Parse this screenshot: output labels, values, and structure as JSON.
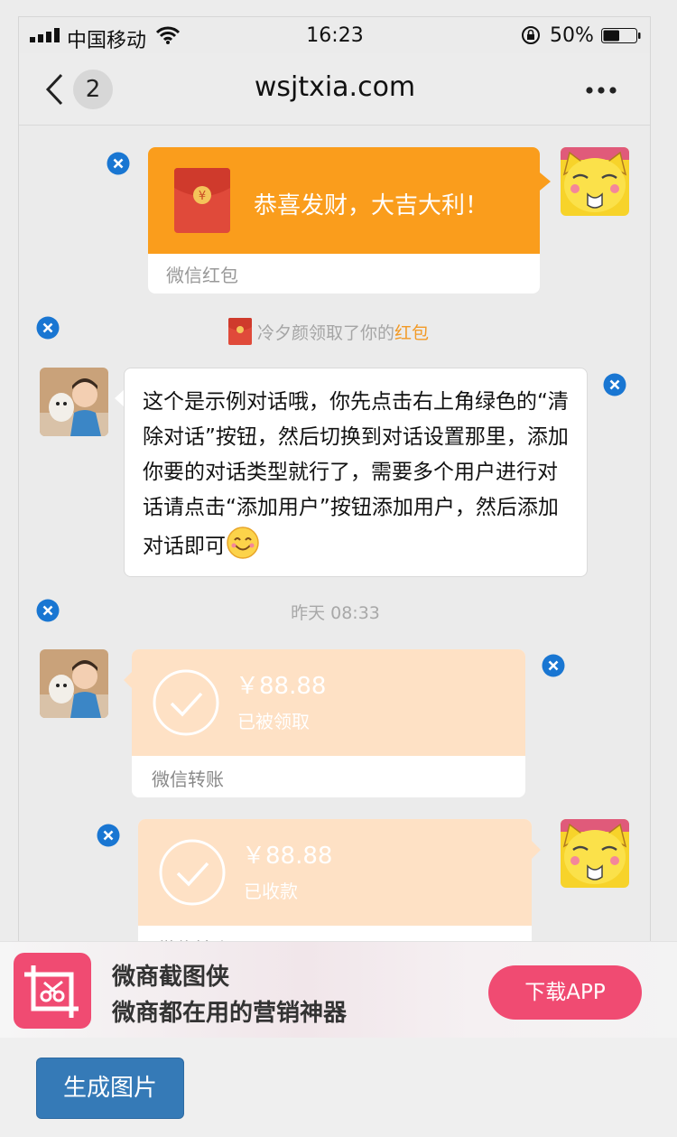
{
  "status_bar": {
    "carrier": "中国移动",
    "time": "16:23",
    "battery_percent": "50%",
    "battery_level": 0.5
  },
  "nav": {
    "unread_count": "2",
    "title": "wsjtxia.com"
  },
  "messages": {
    "red_packet": {
      "wish": "恭喜发财，大吉大利！",
      "footer": "微信红包",
      "envelope_glyph": "¥"
    },
    "system_notice": {
      "prefix": "冷夕颜领取了你的",
      "highlight": "红包"
    },
    "text_message": {
      "text": "这个是示例对话哦，你先点击右上角绿色的“清除对话”按钮，然后切换到对话设置那里，添加你要的对话类型就行了，需要多个用户进行对话请点击“添加用户”按钮添加用户，然后添加对话即可"
    },
    "timestamp": "昨天 08:33",
    "transfer_received": {
      "amount": "￥88.88",
      "status": "已被领取",
      "footer": "微信转账"
    },
    "transfer_sent": {
      "amount": "￥88.88",
      "status": "已收款",
      "footer": "微信转账"
    }
  },
  "ad": {
    "app_name": "微商截图侠",
    "slogan": "微商都在用的营销神器",
    "download_label": "下载APP"
  },
  "actions": {
    "generate_label": "生成图片"
  },
  "colors": {
    "red_packet": "#fa9d1c",
    "transfer": "#fee1c5",
    "delete_badge": "#1976d2",
    "ad_accent": "#f04b72",
    "primary_button": "#357ab7"
  },
  "icons": [
    "signal-icon",
    "wifi-icon",
    "rotation-lock-icon",
    "battery-icon",
    "back-chevron-icon",
    "more-icon",
    "delete-icon",
    "red-envelope-icon",
    "check-circle-icon",
    "smile-emoji-icon",
    "crop-logo-icon"
  ]
}
